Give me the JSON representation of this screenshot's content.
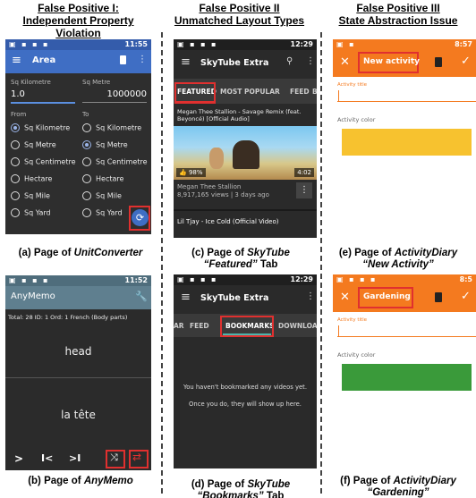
{
  "headings": {
    "col1": "False Positive I:\nIndependent Property\nViolation",
    "col2": "False Positive II\nUnmatched Layout Types",
    "col3": "False Positive III\nState Abstraction Issue"
  },
  "captions": {
    "a_pre": "(a) Page of ",
    "a_app": "UnitConverter",
    "b_pre": "(b) Page of ",
    "b_app": "AnyMemo",
    "c_pre": "(c) Page of ",
    "c_app": "SkyTube",
    "c_tab": "“Featured”",
    "c_post": " Tab",
    "d_pre": "(d) Page of ",
    "d_app": "SkyTube",
    "d_tab": "“Bookmarks”",
    "d_post": " Tab",
    "e_pre": "(e) Page of ",
    "e_app": "ActivityDiary",
    "e_sub": "“New Activity”",
    "f_pre": "(f) Page of ",
    "f_app": "ActivityDiary",
    "f_sub": "“Gardening”"
  },
  "unit_converter": {
    "time": "11:55",
    "title": "Area",
    "from_unit_label": "Sq Kilometre",
    "to_unit_label": "Sq Metre",
    "from_value": "1.0",
    "to_value": "1000000",
    "from_label": "From",
    "to_label": "To",
    "units": [
      "Sq Kilometre",
      "Sq Metre",
      "Sq Centimetre",
      "Hectare",
      "Sq Mile",
      "Sq Yard"
    ]
  },
  "anymemo": {
    "time": "11:52",
    "title": "AnyMemo",
    "info": "Total: 28 ID: 1 Ord: 1 French (Body parts)",
    "front": "head",
    "back": "la tête"
  },
  "skytube_featured": {
    "time": "12:29",
    "title": "SkyTube Extra",
    "tabs": [
      "FEATURED",
      "MOST POPULAR",
      "FEED",
      "B"
    ],
    "video1_title": "Megan Thee Stallion - Savage Remix (feat. Beyoncé) [Official Audio]",
    "like_pct": "98%",
    "duration": "4:02",
    "channel": "Megan Thee Stallion",
    "views": "8,917,165 views  |  3 days ago",
    "video2_title": "Lil Tjay - Ice Cold (Official Video)"
  },
  "skytube_bookmarks": {
    "time": "12:29",
    "title": "SkyTube Extra",
    "tabs": [
      "AR",
      "FEED",
      "BOOKMARKS",
      "DOWNLOADS"
    ],
    "empty1": "You haven't bookmarked any videos yet.",
    "empty2": "Once you do, they will show up here."
  },
  "activity_new": {
    "time": "8:57",
    "title": "New activity",
    "title_label": "Activity title",
    "color_label": "Activity color",
    "color": "#f7c22f"
  },
  "activity_garden": {
    "time": "8:5",
    "title": "Gardening",
    "title_label": "Activity title",
    "color_label": "Activity color",
    "color": "#3a9a3a"
  },
  "colors": {
    "uc_toolbar": "#3f6ec4",
    "uc_bg": "#2e2e2e",
    "memo_bar": "#5f7f8f",
    "memo_bg": "#2b2b2b",
    "sky_bar": "#2a2a2a",
    "act_bar": "#f47a1f",
    "highlight": "#e0302f"
  }
}
